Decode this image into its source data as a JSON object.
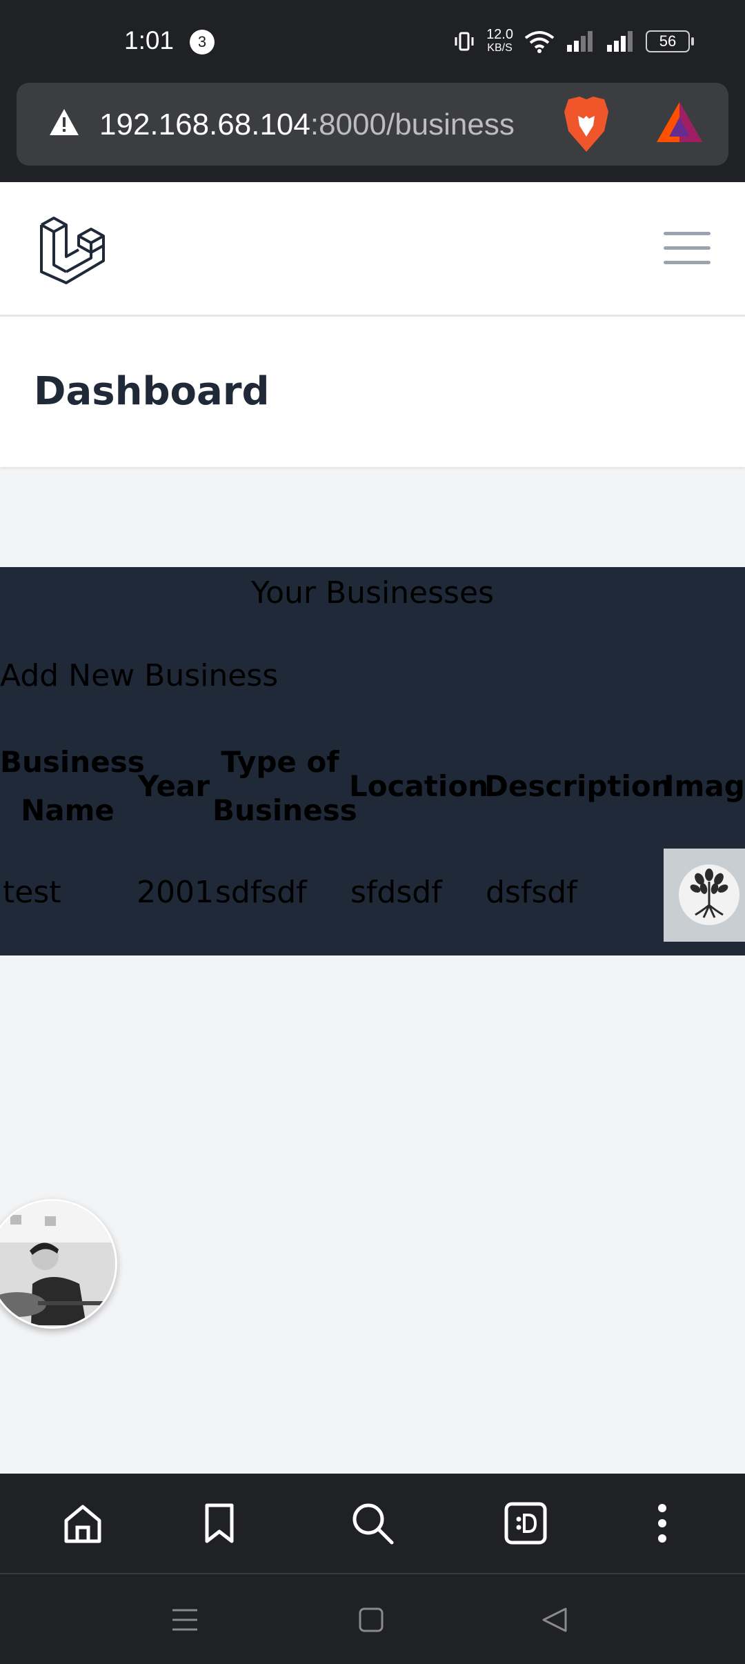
{
  "status_bar": {
    "time": "1:01",
    "notification_count": "3",
    "net_speed_value": "12.0",
    "net_speed_unit": "KB/S",
    "battery": "56"
  },
  "browser": {
    "url_host": "192.168.68.104",
    "url_rest": ":8000/business"
  },
  "header": {
    "title": "Dashboard"
  },
  "businesses": {
    "heading": "Your Businesses",
    "add_link": "Add New Business",
    "columns": [
      {
        "line1": "Business",
        "line2": "Name"
      },
      {
        "line1": "Year",
        "line2": ""
      },
      {
        "line1": "Type of",
        "line2": "Business"
      },
      {
        "line1": "Location",
        "line2": ""
      },
      {
        "line1": "Description",
        "line2": ""
      },
      {
        "line1": "Image",
        "line2": ""
      }
    ],
    "rows": [
      {
        "name": "test",
        "year": "2001",
        "type": "sdfsdf",
        "location": "sfdsdf",
        "description": "dsfsdf"
      }
    ]
  },
  "colors": {
    "panel_bg": "#1f2937",
    "page_bg": "#f3f4f6",
    "browser_chrome": "#202124"
  },
  "icons": {
    "toolbar": [
      "home-icon",
      "bookmark-icon",
      "search-icon",
      "tabs-icon",
      "more-icon"
    ],
    "system_nav": [
      "recents-icon",
      "home-square-icon",
      "back-icon"
    ]
  }
}
